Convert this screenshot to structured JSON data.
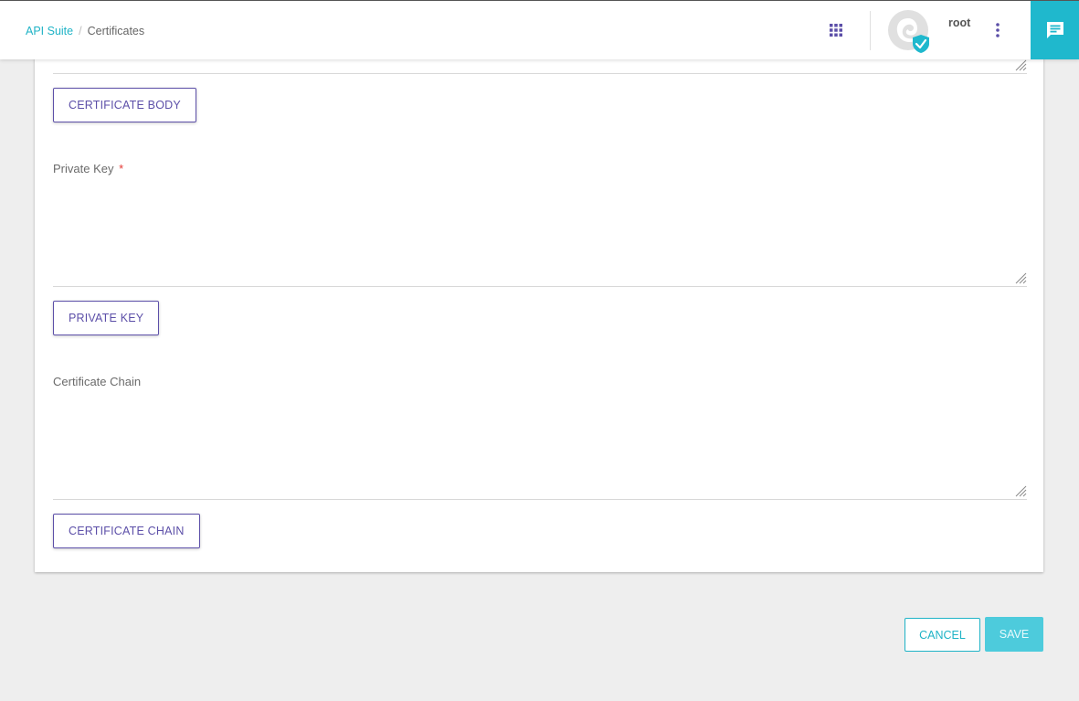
{
  "header": {
    "breadcrumb": {
      "root": "API Suite",
      "separator": "/",
      "current": "Certificates"
    },
    "username": "root",
    "icons": {
      "apps": "apps-grid-icon",
      "avatar": "avatar-verified-icon",
      "more": "more-vert-icon",
      "chat": "chat-icon"
    },
    "colors": {
      "accent": "#1fb3c6",
      "primary_purple": "#5c4fa8",
      "chat_bg": "#1fb8cd"
    }
  },
  "form": {
    "certificate_body": {
      "value": "",
      "upload_button": "CERTIFICATE BODY"
    },
    "private_key": {
      "label": "Private Key",
      "required_marker": "*",
      "value": "",
      "upload_button": "PRIVATE KEY"
    },
    "certificate_chain": {
      "label": "Certificate Chain",
      "value": "",
      "upload_button": "CERTIFICATE CHAIN"
    }
  },
  "actions": {
    "cancel": "CANCEL",
    "save": "SAVE"
  }
}
